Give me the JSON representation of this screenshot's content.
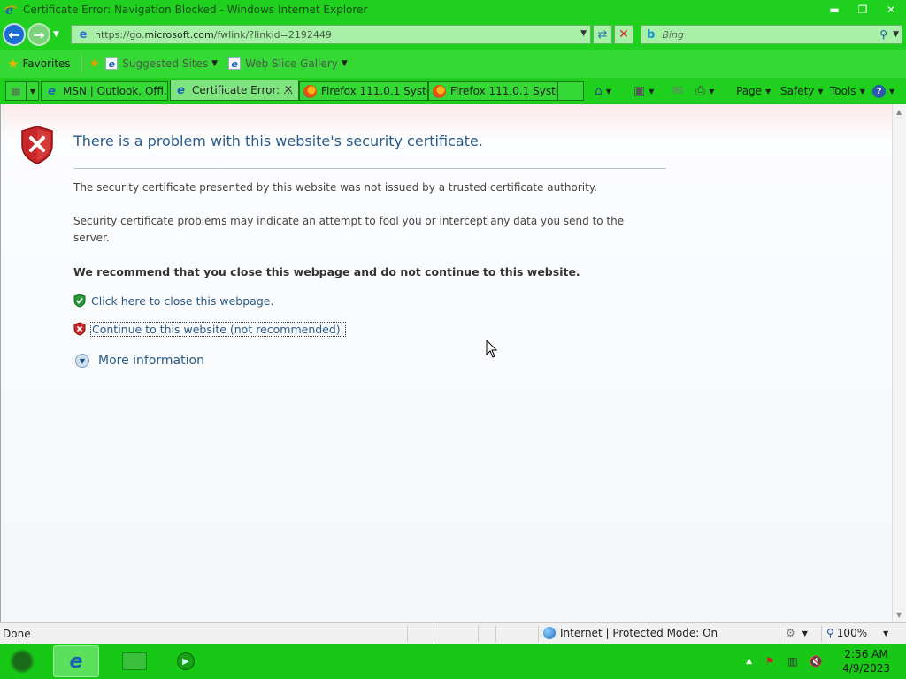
{
  "window": {
    "title": "Certificate Error: Navigation Blocked - Windows Internet Explorer",
    "minimize": "▬",
    "restore": "❐",
    "close": "✕"
  },
  "nav": {
    "url_prefix": "https://go.",
    "url_domain": "microsoft.com",
    "url_path": "/fwlink/?linkid=2192449",
    "search_placeholder": "Bing"
  },
  "favorites_bar": {
    "favorites_label": "Favorites",
    "suggested_sites_label": "Suggested Sites",
    "web_slice_gallery_label": "Web Slice Gallery"
  },
  "tabs": [
    {
      "label": "MSN | Outlook, Offi...",
      "icon": "ie-icon",
      "active": false
    },
    {
      "label": "Certificate Error: ...",
      "icon": "ie-icon",
      "active": true
    },
    {
      "label": "Firefox 111.0.1 Syste...",
      "icon": "firefox-icon",
      "active": false
    },
    {
      "label": "Firefox 111.0.1 Syste...",
      "icon": "firefox-icon",
      "active": false
    }
  ],
  "command_bar": {
    "page_label": "Page",
    "safety_label": "Safety",
    "tools_label": "Tools"
  },
  "content": {
    "heading": "There is a problem with this website's security certificate.",
    "para1": "The security certificate presented by this website was not issued by a trusted certificate authority.",
    "para2": "Security certificate problems may indicate an attempt to fool you or intercept any data you send to the server.",
    "recommend": "We recommend that you close this webpage and do not continue to this website.",
    "close_link": "Click here to close this webpage.",
    "continue_link": "Continue to this website (not recommended).",
    "more_info": "More information"
  },
  "status": {
    "text": "Done",
    "zone": "Internet | Protected Mode: On",
    "zoom": "100%"
  },
  "taskbar": {
    "time": "2:56 AM",
    "date": "4/9/2023"
  },
  "colors": {
    "chrome_green": "#1fd01f",
    "link_blue": "#2b5a87",
    "shield_red": "#c8282a",
    "shield_green": "#2a9a3a"
  }
}
